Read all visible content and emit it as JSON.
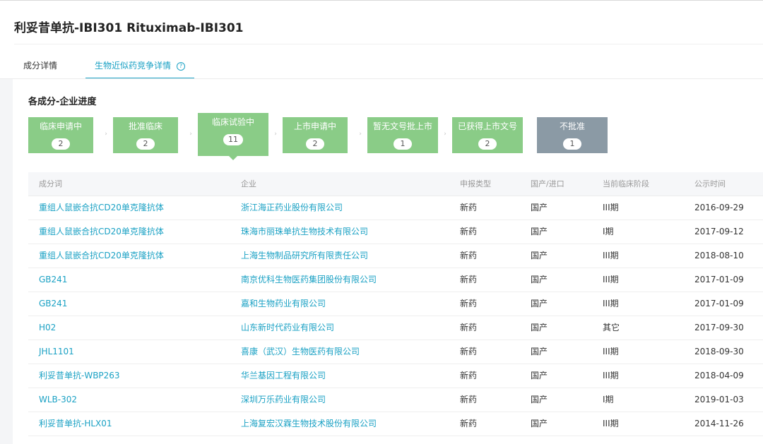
{
  "page": {
    "title": "利妥昔单抗-IBI301 Rituximab-IBI301"
  },
  "tabs": [
    {
      "label": "成分详情",
      "active": false
    },
    {
      "label": "生物近似药竞争详情",
      "active": true,
      "help_icon": "question-circle-icon",
      "help_glyph": "?"
    }
  ],
  "section": {
    "title": "各成分-企业进度"
  },
  "stages": [
    {
      "label": "临床申请中",
      "count": "2"
    },
    {
      "label": "批准临床",
      "count": "2"
    },
    {
      "label": "临床试验中",
      "count": "11",
      "active": true
    },
    {
      "label": "上市申请中",
      "count": "2"
    },
    {
      "label": "暂无文号批上市",
      "count": "1"
    },
    {
      "label": "已获得上市文号",
      "count": "2"
    },
    {
      "label": "不批准",
      "count": "1",
      "status": "rejected"
    }
  ],
  "stage_arrow_glyph": "›",
  "colors": {
    "accent": "#1aa1c4",
    "stage_green": "#8acc87",
    "stage_gray": "#8b9aa5"
  },
  "table": {
    "headers": [
      "成分词",
      "企业",
      "申报类型",
      "国产/进口",
      "当前临床阶段",
      "公示时间"
    ],
    "rows": [
      [
        "重组人鼠嵌合抗CD20单克隆抗体",
        "浙江海正药业股份有限公司",
        "新药",
        "国产",
        "III期",
        "2016-09-29"
      ],
      [
        "重组人鼠嵌合抗CD20单克隆抗体",
        "珠海市丽珠单抗生物技术有限公司",
        "新药",
        "国产",
        "I期",
        "2017-09-12"
      ],
      [
        "重组人鼠嵌合抗CD20单克隆抗体",
        "上海生物制品研究所有限责任公司",
        "新药",
        "国产",
        "III期",
        "2018-08-10"
      ],
      [
        "GB241",
        "南京优科生物医药集团股份有限公司",
        "新药",
        "国产",
        "III期",
        "2017-01-09"
      ],
      [
        "GB241",
        "嘉和生物药业有限公司",
        "新药",
        "国产",
        "III期",
        "2017-01-09"
      ],
      [
        "H02",
        "山东新时代药业有限公司",
        "新药",
        "国产",
        "其它",
        "2017-09-30"
      ],
      [
        "JHL1101",
        "喜康（武汉）生物医药有限公司",
        "新药",
        "国产",
        "III期",
        "2018-09-30"
      ],
      [
        "利妥昔单抗-WBP263",
        "华兰基因工程有限公司",
        "新药",
        "国产",
        "III期",
        "2018-04-09"
      ],
      [
        "WLB-302",
        "深圳万乐药业有限公司",
        "新药",
        "国产",
        "I期",
        "2019-01-03"
      ],
      [
        "利妥昔单抗-HLX01",
        "上海复宏汉霖生物技术股份有限公司",
        "新药",
        "国产",
        "III期",
        "2014-11-26"
      ]
    ]
  }
}
